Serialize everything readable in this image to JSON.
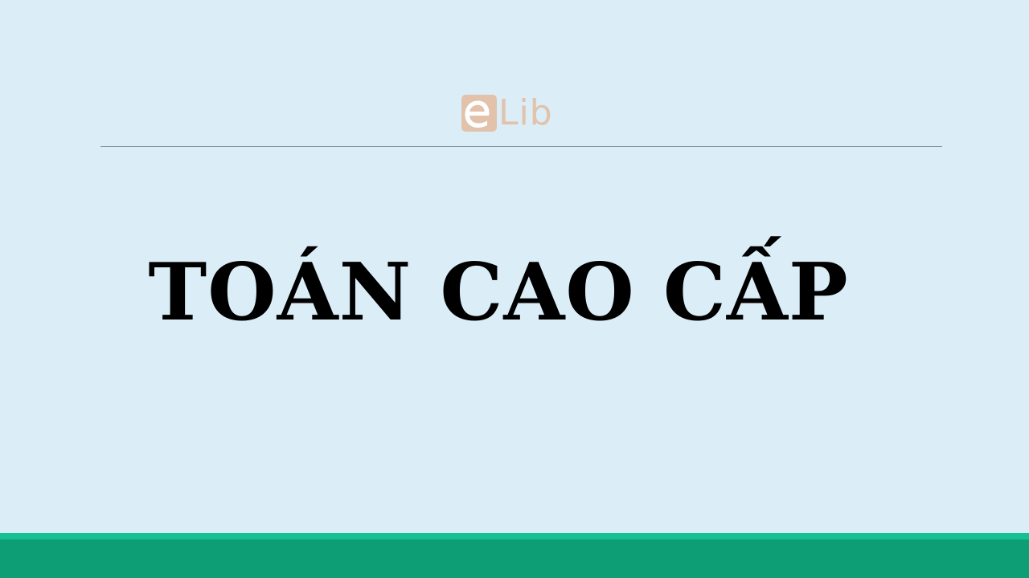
{
  "logo": {
    "e_letter": "e",
    "text": "Lib",
    "color": "#e2c2ab"
  },
  "title": "TOÁN CAO CẤP",
  "colors": {
    "background": "#dbeef8",
    "footer_stripe": "#14c193",
    "footer_bar": "#0e9e76",
    "divider": "#8a95a0"
  }
}
